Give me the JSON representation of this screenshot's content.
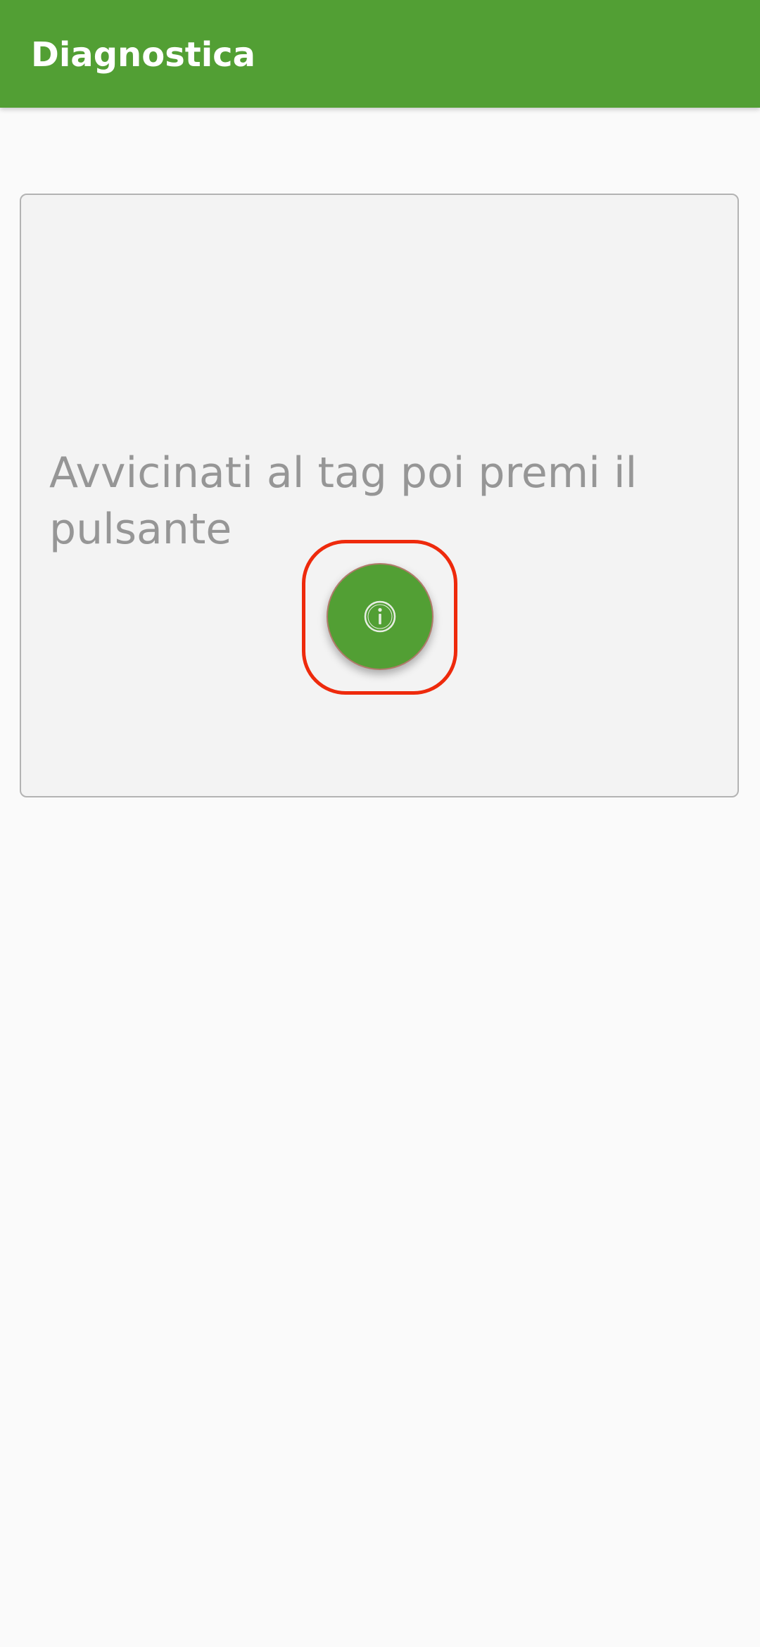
{
  "app_bar": {
    "title": "Diagnostica",
    "background_color": "#529f34"
  },
  "card": {
    "message": "Avvicinati al tag poi premi il pulsante"
  },
  "fab": {
    "icon": "info-icon",
    "background_color": "#529f34"
  },
  "highlight_color": "#ee2a0c"
}
